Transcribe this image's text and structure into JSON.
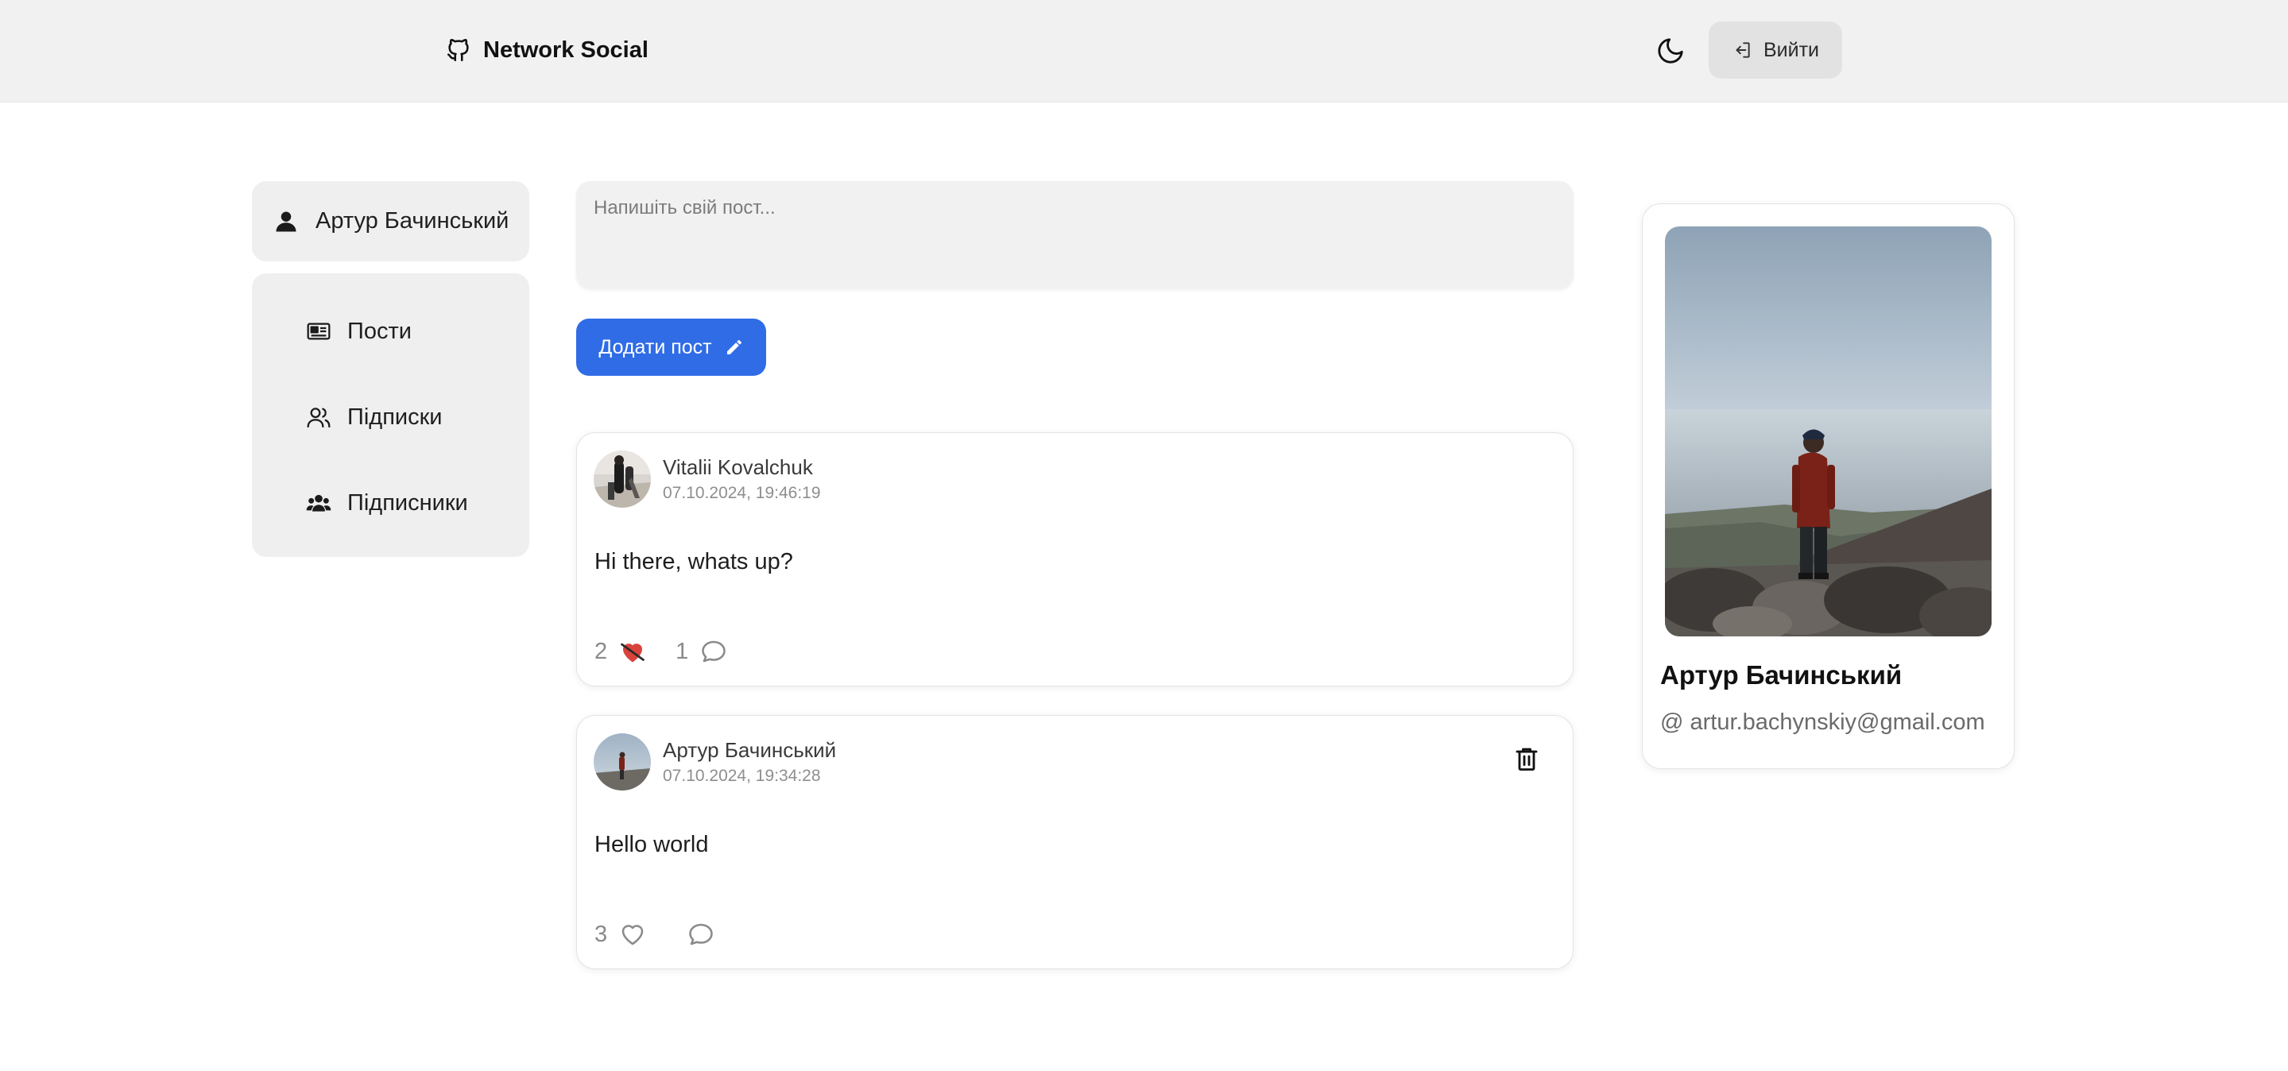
{
  "header": {
    "brand": "Network Social",
    "brand_icon": "github-icon",
    "theme_icon": "moon-icon",
    "logout_label": "Вийти",
    "logout_icon": "logout-icon"
  },
  "sidebar": {
    "profile_name": "Артур Бачинський",
    "profile_icon": "user-icon",
    "items": [
      {
        "label": "Пости",
        "icon": "newspaper-icon"
      },
      {
        "label": "Підписки",
        "icon": "users-icon"
      },
      {
        "label": "Підписники",
        "icon": "users-group-icon"
      }
    ]
  },
  "composer": {
    "placeholder": "Напишіть свій пост...",
    "value": "",
    "submit_label": "Додати пост",
    "submit_icon": "pencil-icon"
  },
  "posts": [
    {
      "author": "Vitalii Kovalchuk",
      "date": "07.10.2024, 19:46:19",
      "text": "Hi there, whats up?",
      "likes": "2",
      "liked": true,
      "comments": "1",
      "deletable": false
    },
    {
      "author": "Артур Бачинський",
      "date": "07.10.2024, 19:34:28",
      "text": "Hello world",
      "likes": "3",
      "liked": false,
      "comments": "",
      "deletable": true
    }
  ],
  "profile_card": {
    "name": "Артур Бачинський",
    "email": "artur.bachynskiy@gmail.com",
    "email_prefix": "@"
  },
  "colors": {
    "accent": "#2f6ce6",
    "header_bg": "#f1f1f1",
    "liked_heart": "#d9433b"
  }
}
